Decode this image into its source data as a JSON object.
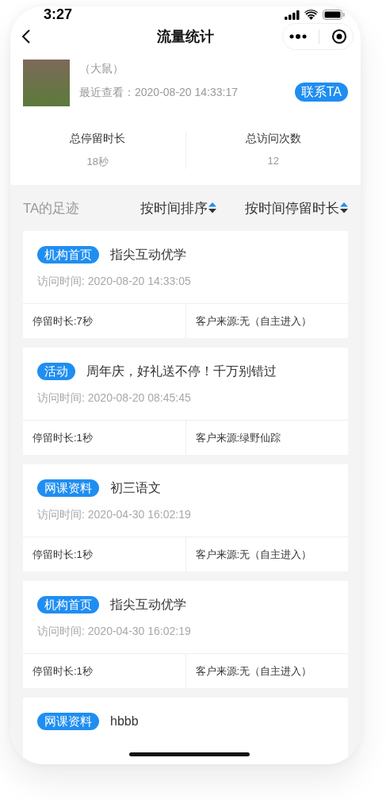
{
  "status_bar": {
    "time": "3:27"
  },
  "nav": {
    "title": "流量统计"
  },
  "profile": {
    "name": "（大鼠）",
    "last_viewed": "最近查看：2020-08-20 14:33:17",
    "contact_button": "联系TA"
  },
  "stats": [
    {
      "label": "总停留时长",
      "value": "18秒"
    },
    {
      "label": "总访问次数",
      "value": "12"
    }
  ],
  "footprint": {
    "title": "TA的足迹",
    "sorts": [
      "按时间排序",
      "按时间停留时长"
    ]
  },
  "visits": [
    {
      "tag": "机构首页",
      "title": "指尖互动优学",
      "visit_time": "访问时间: 2020-08-20 14:33:05",
      "duration": "停留时长:7秒",
      "source": "客户来源:无（自主进入）"
    },
    {
      "tag": "活动",
      "title": "周年庆，好礼送不停！千万别错过",
      "visit_time": "访问时间: 2020-08-20 08:45:45",
      "duration": "停留时长:1秒",
      "source": "客户来源:绿野仙踪"
    },
    {
      "tag": "网课资料",
      "title": "初三语文",
      "visit_time": "访问时间: 2020-04-30 16:02:19",
      "duration": "停留时长:1秒",
      "source": "客户来源:无（自主进入）"
    },
    {
      "tag": "机构首页",
      "title": "指尖互动优学",
      "visit_time": "访问时间: 2020-04-30 16:02:19",
      "duration": "停留时长:1秒",
      "source": "客户来源:无（自主进入）"
    },
    {
      "tag": "网课资料",
      "title": "hbbb"
    }
  ]
}
